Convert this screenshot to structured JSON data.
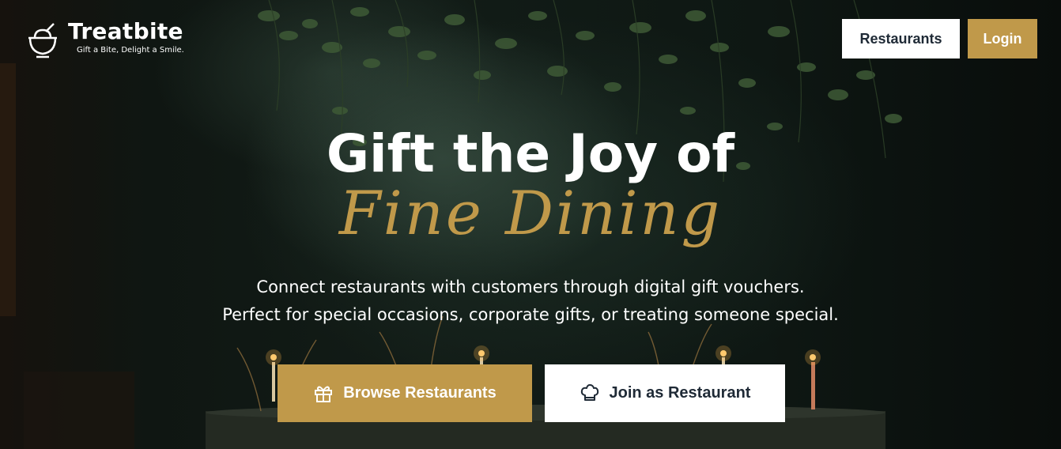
{
  "brand": {
    "name": "Treatbite",
    "tagline": "Gift a Bite, Delight a Smile.",
    "icon": "bowl-icon"
  },
  "nav": {
    "restaurants_label": "Restaurants",
    "login_label": "Login"
  },
  "hero": {
    "headline": "Gift the Joy of",
    "headline_accent": "Fine Dining",
    "subtitle_line1": "Connect restaurants with customers through digital gift vouchers.",
    "subtitle_line2": "Perfect for special occasions, corporate gifts, or treating someone special."
  },
  "cta": {
    "browse_label": "Browse Restaurants",
    "browse_icon": "gift-icon",
    "join_label": "Join as Restaurant",
    "join_icon": "chef-hat-icon"
  },
  "colors": {
    "accent": "#c0994a",
    "text_dark": "#1f2a36",
    "white": "#ffffff"
  }
}
